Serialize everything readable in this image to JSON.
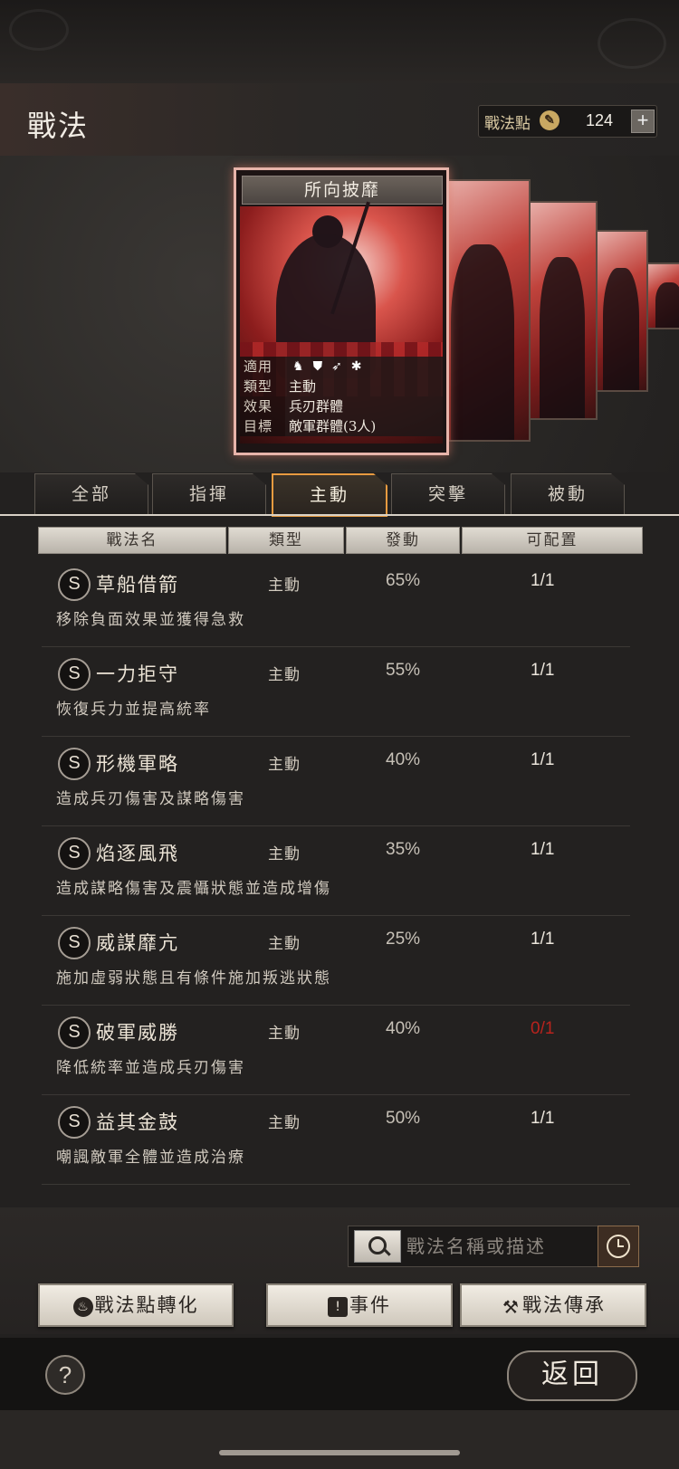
{
  "header": {
    "title": "戰法",
    "points_label": "戰法點",
    "points_value": "124",
    "add_symbol": "+"
  },
  "card": {
    "name": "所向披靡",
    "info": [
      {
        "key": "適用",
        "value": ""
      },
      {
        "key": "類型",
        "value": "主動"
      },
      {
        "key": "效果",
        "value": "兵刃群體"
      },
      {
        "key": "目標",
        "value": "敵軍群體(3人)"
      }
    ],
    "unit_icons": [
      "cavalry-icon",
      "shield-icon",
      "bow-icon",
      "wheel-icon"
    ]
  },
  "tabs": [
    {
      "label": "全部",
      "active": false
    },
    {
      "label": "指揮",
      "active": false
    },
    {
      "label": "主動",
      "active": true
    },
    {
      "label": "突擊",
      "active": false
    },
    {
      "label": "被動",
      "active": false
    }
  ],
  "columns": [
    "戰法名",
    "類型",
    "發動",
    "可配置"
  ],
  "skills": [
    {
      "grade": "S",
      "name": "草船借箭",
      "type": "主動",
      "rate": "65%",
      "quota": "1/1",
      "desc": "移除負面效果並獲得急救"
    },
    {
      "grade": "S",
      "name": "一力拒守",
      "type": "主動",
      "rate": "55%",
      "quota": "1/1",
      "desc": "恢復兵力並提高統率"
    },
    {
      "grade": "S",
      "name": "形機軍略",
      "type": "主動",
      "rate": "40%",
      "quota": "1/1",
      "desc": "造成兵刃傷害及謀略傷害"
    },
    {
      "grade": "S",
      "name": "焰逐風飛",
      "type": "主動",
      "rate": "35%",
      "quota": "1/1",
      "desc": "造成謀略傷害及震懾狀態並造成增傷"
    },
    {
      "grade": "S",
      "name": "威謀靡亢",
      "type": "主動",
      "rate": "25%",
      "quota": "1/1",
      "desc": "施加虛弱狀態且有條件施加叛逃狀態"
    },
    {
      "grade": "S",
      "name": "破軍威勝",
      "type": "主動",
      "rate": "40%",
      "quota": "0/1",
      "desc": "降低統率並造成兵刃傷害"
    },
    {
      "grade": "S",
      "name": "益其金鼓",
      "type": "主動",
      "rate": "50%",
      "quota": "1/1",
      "desc": "嘲諷敵軍全體並造成治療"
    }
  ],
  "colors": {
    "quota_empty": "#b8231d",
    "tab_active_border": "#e89b40"
  },
  "search": {
    "placeholder": "戰法名稱或描述"
  },
  "buttons": {
    "convert": "戰法點轉化",
    "events": "事件",
    "inherit": "戰法傳承"
  },
  "footer": {
    "help": "?",
    "back": "返回"
  }
}
